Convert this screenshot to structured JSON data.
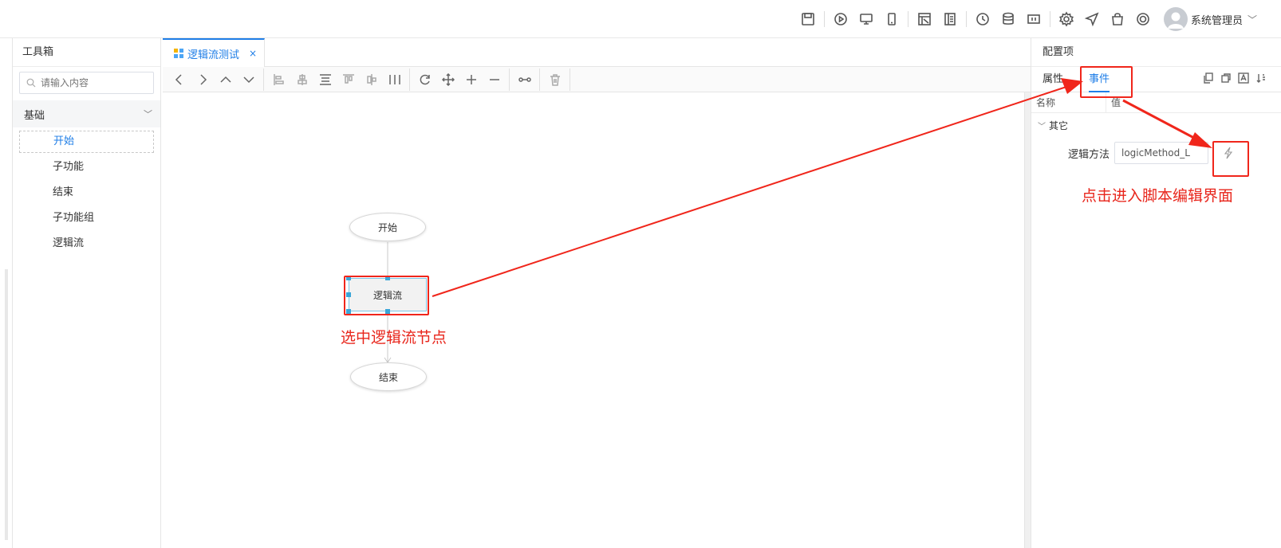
{
  "header": {
    "user_name": "系统管理员"
  },
  "icons": {
    "top": [
      "save-icon",
      "play-icon",
      "desktop-icon",
      "tablet-icon",
      "layout-icon",
      "page-icon",
      "clock-icon",
      "database-icon",
      "table-icon",
      "settings-icon",
      "send-icon",
      "bag-icon",
      "help-icon"
    ]
  },
  "toolbox": {
    "title": "工具箱",
    "search_placeholder": "请输入内容",
    "category": "基础",
    "items": [
      {
        "label": "开始"
      },
      {
        "label": "子功能"
      },
      {
        "label": "结束"
      },
      {
        "label": "子功能组"
      },
      {
        "label": "逻辑流"
      }
    ]
  },
  "editor": {
    "tab_label": "逻辑流测试",
    "tab_close": "×",
    "nodes": {
      "start": "开始",
      "logic": "逻辑流",
      "end": "结束"
    }
  },
  "config": {
    "title": "配置项",
    "tabs": [
      {
        "label": "属性"
      },
      {
        "label": "事件"
      }
    ],
    "col_name": "名称",
    "col_value": "值",
    "group": "其它",
    "logic_method_label": "逻辑方法",
    "logic_method_value": "logicMethod_L"
  },
  "annotations": {
    "select_node": "选中逻辑流节点",
    "click_script": "点击进入脚本编辑界面",
    "color": "#e8251b"
  },
  "colors": {
    "accent": "#1f7ee7",
    "annotation_red": "#f0261b"
  }
}
